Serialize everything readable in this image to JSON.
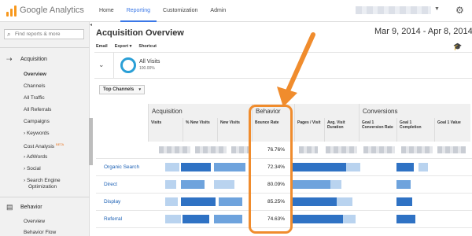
{
  "app": {
    "brand": "Google Analytics"
  },
  "topnav": [
    {
      "label": "Home",
      "active": false
    },
    {
      "label": "Reporting",
      "active": true
    },
    {
      "label": "Customization",
      "active": false
    },
    {
      "label": "Admin",
      "active": false
    }
  ],
  "sidebar": {
    "search_placeholder": "Find reports & more",
    "acquisition_label": "Acquisition",
    "acquisition_items": [
      {
        "label": "Overview",
        "bold": true
      },
      {
        "label": "Channels"
      },
      {
        "label": "All Traffic"
      },
      {
        "label": "All Referrals"
      },
      {
        "label": "Campaigns"
      },
      {
        "label": "› Keywords"
      },
      {
        "label": "Cost Analysis",
        "badge": "BETA"
      },
      {
        "label": "› AdWords"
      },
      {
        "label": "› Social"
      },
      {
        "label": "› Search Engine"
      },
      {
        "label": "Optimization"
      }
    ],
    "behavior_label": "Behavior",
    "behavior_items": [
      {
        "label": "Overview"
      },
      {
        "label": "Behavior Flow"
      }
    ]
  },
  "main": {
    "title": "Acquisition Overview",
    "date_range": "Mar 9, 2014 - Apr 8, 2014",
    "toolbar": {
      "email": "Email",
      "export": "Export",
      "shortcut": "Shortcut"
    },
    "segment": {
      "name": "All Visits",
      "pct": "100.00%"
    },
    "dimension_button": "Top Channels"
  },
  "table": {
    "groups": {
      "acquisition": "Acquisition",
      "behavior": "Behavior",
      "conversions": "Conversions"
    },
    "columns": {
      "visits": "Visits",
      "new_visits": "% New Visits",
      "new_visits_count": "New Visits",
      "bounce": "Bounce Rate",
      "pages": "Pages / Visit",
      "duration": "Avg. Visit Duration",
      "goal_conv": "Goal 1 Conversion Rate",
      "goal_comp": "Goal 1 Completion",
      "goal_val": "Goal 1 Value"
    },
    "total_bounce": "76.76%",
    "rows": [
      {
        "channel": "Organic Search",
        "bounce": "72.34%"
      },
      {
        "channel": "Direct",
        "bounce": "80.09%"
      },
      {
        "channel": "Display",
        "bounce": "85.25%"
      },
      {
        "channel": "Referral",
        "bounce": "74.63%"
      }
    ]
  },
  "colors": {
    "accent": "#3b78e7",
    "highlight": "#f08c2d",
    "bar": "#2f72c4",
    "link": "#1a5fb4"
  },
  "icons": [
    "analytics-logo-icon",
    "gear-icon",
    "search-icon",
    "acquisition-icon",
    "behavior-icon",
    "graduation-cap-icon",
    "chevron-down-icon",
    "arrow-annotation-icon"
  ]
}
